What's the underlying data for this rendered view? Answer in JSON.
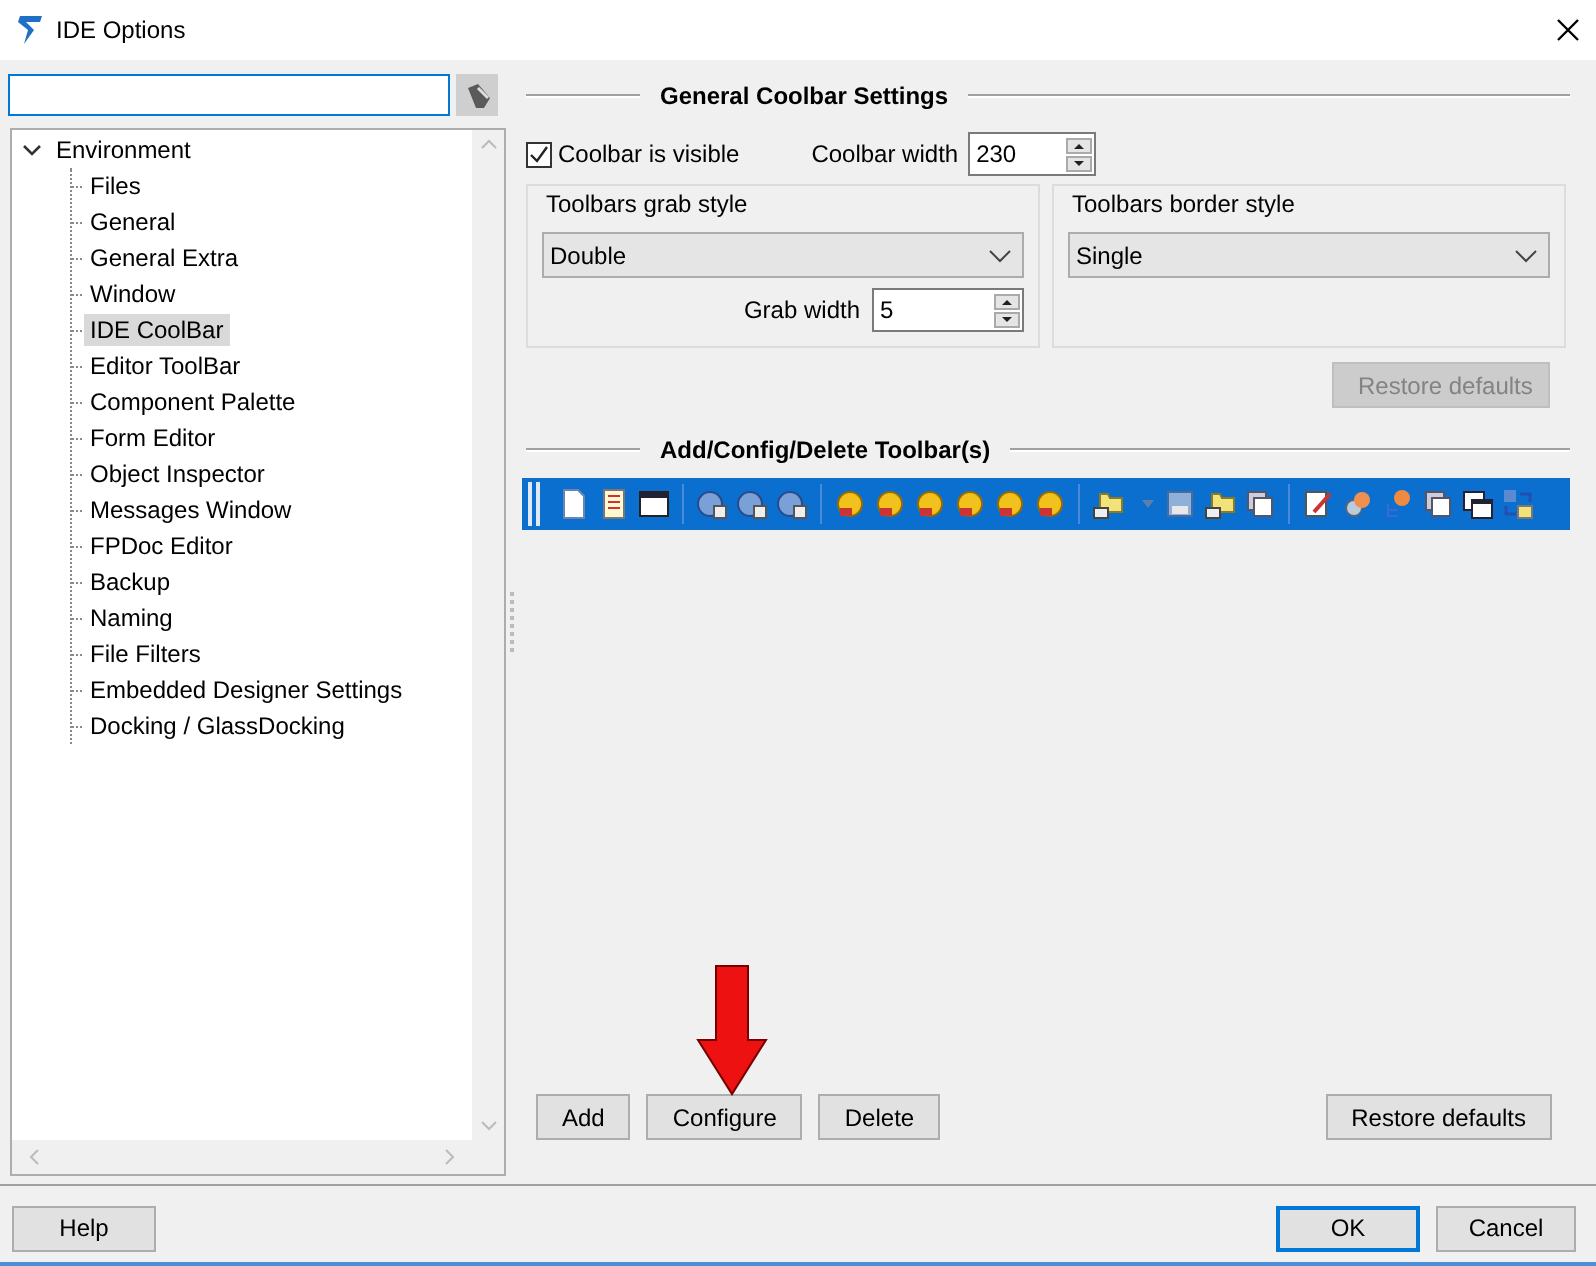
{
  "window": {
    "title": "IDE Options"
  },
  "tree": [
    {
      "label": "Environment",
      "expanded": true,
      "children": [
        {
          "label": "Files",
          "selected": false
        },
        {
          "label": "General",
          "selected": false
        },
        {
          "label": "General Extra",
          "selected": false
        },
        {
          "label": "Window",
          "selected": false
        },
        {
          "label": "IDE CoolBar",
          "selected": true
        },
        {
          "label": "Editor ToolBar",
          "selected": false
        },
        {
          "label": "Component Palette",
          "selected": false
        },
        {
          "label": "Form Editor",
          "selected": false
        },
        {
          "label": "Object Inspector",
          "selected": false
        },
        {
          "label": "Messages Window",
          "selected": false
        },
        {
          "label": "FPDoc Editor",
          "selected": false
        },
        {
          "label": "Backup",
          "selected": false
        },
        {
          "label": "Naming",
          "selected": false
        },
        {
          "label": "File Filters",
          "selected": false
        },
        {
          "label": "Embedded Designer Settings",
          "selected": false
        },
        {
          "label": "Docking / GlassDocking",
          "selected": false
        }
      ]
    }
  ],
  "coolbar": {
    "heading": "General Coolbar Settings",
    "visible": {
      "label": "Coolbar is visible",
      "checked": true
    },
    "width": {
      "label": "Coolbar width",
      "value": "230"
    },
    "grab_style": {
      "title": "Toolbars grab style",
      "value": "Double",
      "width_label": "Grab width",
      "width_value": "5"
    },
    "border_style": {
      "title": "Toolbars border style",
      "value": "Single"
    },
    "restore": {
      "label": "Restore defaults",
      "disabled": true
    }
  },
  "toolbars": {
    "heading": "Add/Config/Delete Toolbar(s)",
    "buttons": [
      {
        "label": "Add"
      },
      {
        "label": "Configure"
      },
      {
        "label": "Delete"
      }
    ],
    "restore": {
      "label": "Restore defaults",
      "disabled": false
    }
  },
  "footer": {
    "help": "Help",
    "ok": "OK",
    "cancel": "Cancel"
  }
}
